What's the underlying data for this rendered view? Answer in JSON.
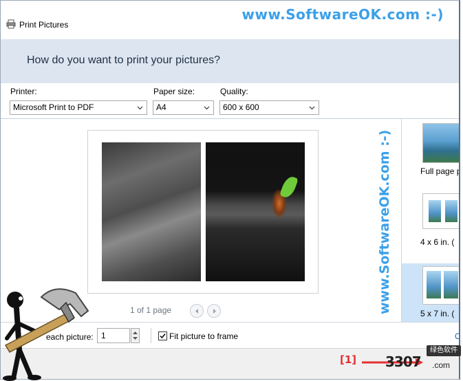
{
  "window": {
    "title": "Print Pictures"
  },
  "watermark": {
    "top": "www.SoftwareOK.com :-)",
    "side": "www.SoftwareOK.com :-)"
  },
  "header": {
    "question": "How do you want to print your pictures?"
  },
  "settings": {
    "printer_label": "Printer:",
    "printer_value": "Microsoft Print to PDF",
    "paper_label": "Paper size:",
    "paper_value": "A4",
    "quality_label": "Quality:",
    "quality_value": "600 x 600"
  },
  "preview": {
    "page_count": "1 of 1 page"
  },
  "layouts": [
    {
      "label": "Full page p"
    },
    {
      "label": "4 x 6 in. ("
    },
    {
      "label": "5 x 7 in. ("
    }
  ],
  "bottom": {
    "copies_label": "each picture:",
    "copies_value": "1",
    "fit_label": "Fit picture to frame",
    "fit_checked": true,
    "options_link": "O"
  },
  "annotation": {
    "marker": "[1]",
    "brand": "3307",
    "brand_suffix": ".com",
    "brand_tag": "绿色软件"
  },
  "colors": {
    "accent": "#3ba0e8",
    "header_band": "#dde6f0",
    "selected": "#cde3f7",
    "annotation": "#e53030"
  }
}
